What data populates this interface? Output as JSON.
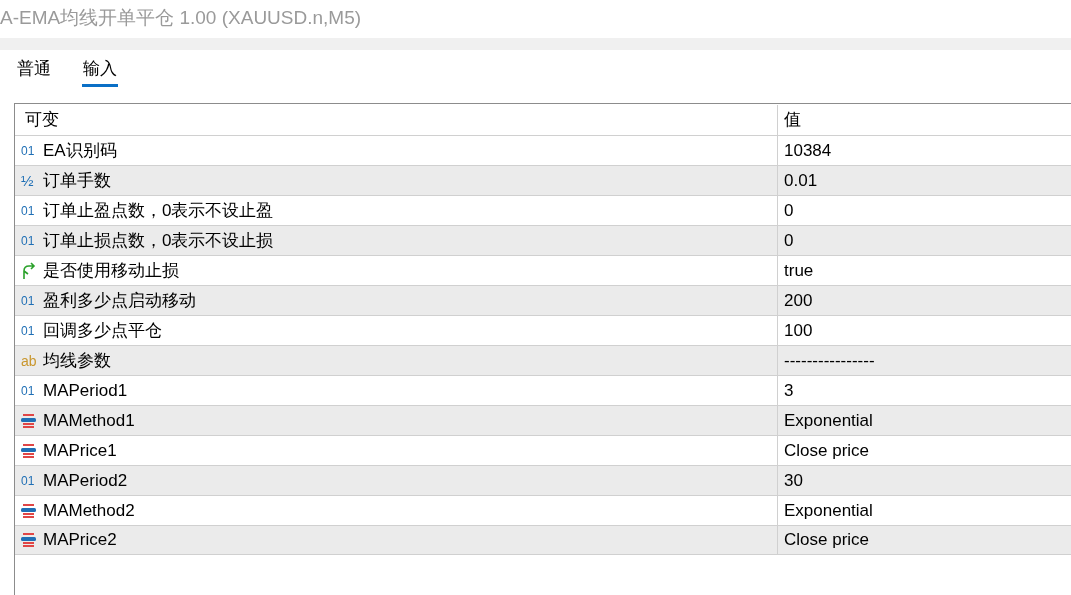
{
  "window": {
    "title": "A-EMA均线开单平仓 1.00 (XAUUSD.n,M5)"
  },
  "tabs": [
    {
      "label": "普通",
      "selected": false
    },
    {
      "label": "输入",
      "selected": true
    }
  ],
  "table": {
    "columns": [
      "可变",
      "值"
    ],
    "rows": [
      {
        "kind": "int",
        "icon": "01",
        "name": "EA识别码",
        "value": "10384"
      },
      {
        "kind": "double",
        "icon": "½",
        "name": "订单手数",
        "value": "0.01"
      },
      {
        "kind": "int",
        "icon": "01",
        "name": "订单止盈点数，0表示不设止盈",
        "value": "0"
      },
      {
        "kind": "int",
        "icon": "01",
        "name": "订单止损点数，0表示不设止损",
        "value": "0"
      },
      {
        "kind": "bool",
        "name": "是否使用移动止损",
        "value": "true"
      },
      {
        "kind": "int",
        "icon": "01",
        "name": "盈利多少点启动移动",
        "value": "200"
      },
      {
        "kind": "int",
        "icon": "01",
        "name": "回调多少点平仓",
        "value": "100"
      },
      {
        "kind": "string",
        "icon": "ab",
        "name": "均线参数",
        "value": "----------------"
      },
      {
        "kind": "int",
        "icon": "01",
        "name": "MAPeriod1",
        "value": "3"
      },
      {
        "kind": "enum",
        "name": "MAMethod1",
        "value": "Exponential"
      },
      {
        "kind": "enum",
        "name": "MAPrice1",
        "value": "Close price"
      },
      {
        "kind": "int",
        "icon": "01",
        "name": "MAPeriod2",
        "value": "30"
      },
      {
        "kind": "enum",
        "name": "MAMethod2",
        "value": "Exponential"
      },
      {
        "kind": "enum",
        "name": "MAPrice2",
        "value": "Close price"
      }
    ]
  }
}
